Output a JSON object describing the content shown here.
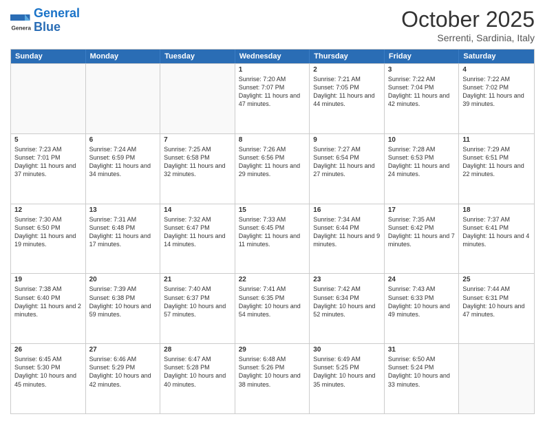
{
  "header": {
    "logo_general": "General",
    "logo_blue": "Blue",
    "month": "October 2025",
    "location": "Serrenti, Sardinia, Italy"
  },
  "days_of_week": [
    "Sunday",
    "Monday",
    "Tuesday",
    "Wednesday",
    "Thursday",
    "Friday",
    "Saturday"
  ],
  "weeks": [
    [
      {
        "day": "",
        "info": ""
      },
      {
        "day": "",
        "info": ""
      },
      {
        "day": "",
        "info": ""
      },
      {
        "day": "1",
        "info": "Sunrise: 7:20 AM\nSunset: 7:07 PM\nDaylight: 11 hours and 47 minutes."
      },
      {
        "day": "2",
        "info": "Sunrise: 7:21 AM\nSunset: 7:05 PM\nDaylight: 11 hours and 44 minutes."
      },
      {
        "day": "3",
        "info": "Sunrise: 7:22 AM\nSunset: 7:04 PM\nDaylight: 11 hours and 42 minutes."
      },
      {
        "day": "4",
        "info": "Sunrise: 7:22 AM\nSunset: 7:02 PM\nDaylight: 11 hours and 39 minutes."
      }
    ],
    [
      {
        "day": "5",
        "info": "Sunrise: 7:23 AM\nSunset: 7:01 PM\nDaylight: 11 hours and 37 minutes."
      },
      {
        "day": "6",
        "info": "Sunrise: 7:24 AM\nSunset: 6:59 PM\nDaylight: 11 hours and 34 minutes."
      },
      {
        "day": "7",
        "info": "Sunrise: 7:25 AM\nSunset: 6:58 PM\nDaylight: 11 hours and 32 minutes."
      },
      {
        "day": "8",
        "info": "Sunrise: 7:26 AM\nSunset: 6:56 PM\nDaylight: 11 hours and 29 minutes."
      },
      {
        "day": "9",
        "info": "Sunrise: 7:27 AM\nSunset: 6:54 PM\nDaylight: 11 hours and 27 minutes."
      },
      {
        "day": "10",
        "info": "Sunrise: 7:28 AM\nSunset: 6:53 PM\nDaylight: 11 hours and 24 minutes."
      },
      {
        "day": "11",
        "info": "Sunrise: 7:29 AM\nSunset: 6:51 PM\nDaylight: 11 hours and 22 minutes."
      }
    ],
    [
      {
        "day": "12",
        "info": "Sunrise: 7:30 AM\nSunset: 6:50 PM\nDaylight: 11 hours and 19 minutes."
      },
      {
        "day": "13",
        "info": "Sunrise: 7:31 AM\nSunset: 6:48 PM\nDaylight: 11 hours and 17 minutes."
      },
      {
        "day": "14",
        "info": "Sunrise: 7:32 AM\nSunset: 6:47 PM\nDaylight: 11 hours and 14 minutes."
      },
      {
        "day": "15",
        "info": "Sunrise: 7:33 AM\nSunset: 6:45 PM\nDaylight: 11 hours and 11 minutes."
      },
      {
        "day": "16",
        "info": "Sunrise: 7:34 AM\nSunset: 6:44 PM\nDaylight: 11 hours and 9 minutes."
      },
      {
        "day": "17",
        "info": "Sunrise: 7:35 AM\nSunset: 6:42 PM\nDaylight: 11 hours and 7 minutes."
      },
      {
        "day": "18",
        "info": "Sunrise: 7:37 AM\nSunset: 6:41 PM\nDaylight: 11 hours and 4 minutes."
      }
    ],
    [
      {
        "day": "19",
        "info": "Sunrise: 7:38 AM\nSunset: 6:40 PM\nDaylight: 11 hours and 2 minutes."
      },
      {
        "day": "20",
        "info": "Sunrise: 7:39 AM\nSunset: 6:38 PM\nDaylight: 10 hours and 59 minutes."
      },
      {
        "day": "21",
        "info": "Sunrise: 7:40 AM\nSunset: 6:37 PM\nDaylight: 10 hours and 57 minutes."
      },
      {
        "day": "22",
        "info": "Sunrise: 7:41 AM\nSunset: 6:35 PM\nDaylight: 10 hours and 54 minutes."
      },
      {
        "day": "23",
        "info": "Sunrise: 7:42 AM\nSunset: 6:34 PM\nDaylight: 10 hours and 52 minutes."
      },
      {
        "day": "24",
        "info": "Sunrise: 7:43 AM\nSunset: 6:33 PM\nDaylight: 10 hours and 49 minutes."
      },
      {
        "day": "25",
        "info": "Sunrise: 7:44 AM\nSunset: 6:31 PM\nDaylight: 10 hours and 47 minutes."
      }
    ],
    [
      {
        "day": "26",
        "info": "Sunrise: 6:45 AM\nSunset: 5:30 PM\nDaylight: 10 hours and 45 minutes."
      },
      {
        "day": "27",
        "info": "Sunrise: 6:46 AM\nSunset: 5:29 PM\nDaylight: 10 hours and 42 minutes."
      },
      {
        "day": "28",
        "info": "Sunrise: 6:47 AM\nSunset: 5:28 PM\nDaylight: 10 hours and 40 minutes."
      },
      {
        "day": "29",
        "info": "Sunrise: 6:48 AM\nSunset: 5:26 PM\nDaylight: 10 hours and 38 minutes."
      },
      {
        "day": "30",
        "info": "Sunrise: 6:49 AM\nSunset: 5:25 PM\nDaylight: 10 hours and 35 minutes."
      },
      {
        "day": "31",
        "info": "Sunrise: 6:50 AM\nSunset: 5:24 PM\nDaylight: 10 hours and 33 minutes."
      },
      {
        "day": "",
        "info": ""
      }
    ]
  ]
}
